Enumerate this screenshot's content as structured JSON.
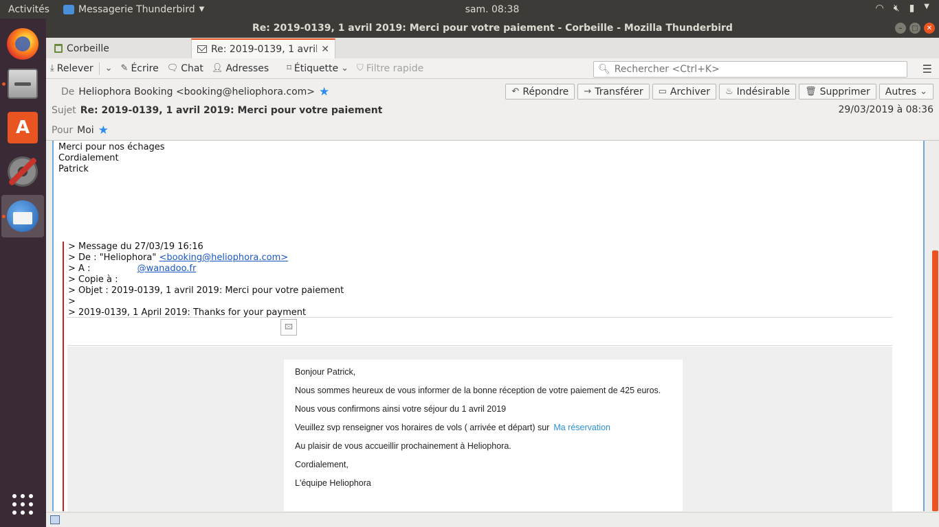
{
  "system": {
    "activities": "Activités",
    "app_menu": "Messagerie Thunderbird",
    "clock": "sam. 08:38",
    "tray_icons": [
      "wifi-icon",
      "volume-muted-icon",
      "battery-icon",
      "chevron-down-icon"
    ]
  },
  "dock": {
    "items": [
      "firefox-icon",
      "files-icon",
      "software-store-icon",
      "system-settings-icon",
      "thunderbird-icon",
      "app-grid-icon"
    ]
  },
  "window": {
    "title": "Re: 2019-0139, 1 avril 2019: Merci pour votre paiement - Corbeille - Mozilla Thunderbird"
  },
  "tabs": [
    {
      "label": "Corbeille"
    },
    {
      "label": "Re: 2019-0139, 1 avril 2019"
    }
  ],
  "toolbar": {
    "get_messages": "Relever",
    "write": "Écrire",
    "chat": "Chat",
    "address_book": "Adresses",
    "tag": "Étiquette",
    "quick_filter": "Filtre rapide",
    "search_placeholder": "Rechercher <Ctrl+K>"
  },
  "header": {
    "from_label": "De",
    "from_value": "Heliophora Booking <booking@heliophora.com>",
    "subject_label": "Sujet",
    "subject_value": "Re: 2019-0139, 1 avril 2019: Merci pour votre paiement",
    "to_label": "Pour",
    "to_value": "Moi",
    "date": "29/03/2019 à 08:36",
    "actions": {
      "reply": "Répondre",
      "forward": "Transférer",
      "archive": "Archiver",
      "junk": "Indésirable",
      "delete": "Supprimer",
      "other": "Autres"
    }
  },
  "message": {
    "body_lines": [
      "Merci pour nos échages",
      "Cordialement",
      "Patrick"
    ],
    "quote_lines": {
      "l1": "> Message du 27/03/19 16:16",
      "l2_prefix": "> De : \"Heliophora\" ",
      "l2_link": "<booking@heliophora.com>",
      "l3_prefix": "> A : ",
      "l3_link": "@wanadoo.fr",
      "l4": "> Copie à :",
      "l5": "> Objet : 2019-0139, 1 avril 2019: Merci pour votre paiement",
      "l6": ">",
      "l7": "> 2019-0139, 1 April 2019: Thanks for your payment"
    },
    "card": {
      "greeting": "Bonjour Patrick,",
      "p1": "Nous sommes heureux de vous informer de la bonne réception de votre paiement de 425 euros.",
      "p2": "Nous vous confirmons ainsi votre séjour du 1 avril 2019",
      "p3": "Veuillez svp renseigner vos horaires de vols ( arrivée et départ) sur",
      "p3_link": "Ma réservation",
      "p4": "Au plaisir de vous accueillir prochainement à Heliophora.",
      "p5": "Cordialement,",
      "p6": "L'équipe Heliophora"
    }
  },
  "colors": {
    "accent": "#e95420",
    "star": "#2f8cf0",
    "quote_bar": "#c8201e",
    "link": "#1a56c8"
  }
}
